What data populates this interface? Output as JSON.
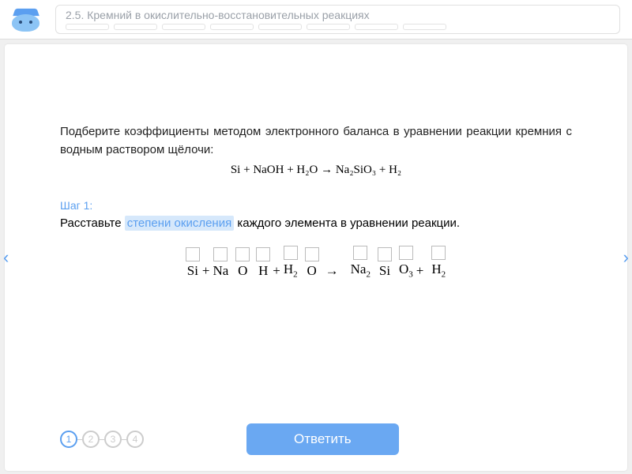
{
  "header": {
    "title": "2.5. Кремний в окислительно-восстановительных реакциях",
    "progress_slots": 8
  },
  "problem": {
    "text": "Подберите коэффициенты методом электронного баланса в уравнении реакции кремния с водным раствором щёлочи:",
    "equation": "Si + NaOH + H₂O → Na₂SiO₃ + H₂"
  },
  "step": {
    "label": "Шаг 1:",
    "prefix": "Расставьте ",
    "highlight": "степени окисления",
    "suffix": " каждого элемента в уравнении реакции."
  },
  "work_tokens": [
    {
      "type": "box",
      "sym": "Si"
    },
    {
      "type": "op",
      "sym": "+"
    },
    {
      "type": "box",
      "sym": "Na"
    },
    {
      "type": "gap"
    },
    {
      "type": "box",
      "sym": "O"
    },
    {
      "type": "gap"
    },
    {
      "type": "box",
      "sym": "H"
    },
    {
      "type": "op",
      "sym": "+"
    },
    {
      "type": "box",
      "sym": "H",
      "sub": "2"
    },
    {
      "type": "gap"
    },
    {
      "type": "box",
      "sym": "O"
    },
    {
      "type": "arrow",
      "sym": "→"
    },
    {
      "type": "gap"
    },
    {
      "type": "box",
      "sym": "Na",
      "sub": "2"
    },
    {
      "type": "gap"
    },
    {
      "type": "box",
      "sym": "Si"
    },
    {
      "type": "gap"
    },
    {
      "type": "box",
      "sym": "O",
      "sub": "3"
    },
    {
      "type": "op",
      "sym": "+"
    },
    {
      "type": "gap"
    },
    {
      "type": "box",
      "sym": "H",
      "sub": "2"
    }
  ],
  "pager": {
    "steps": [
      "1",
      "2",
      "3",
      "4"
    ],
    "active": 0
  },
  "buttons": {
    "answer": "Ответить"
  },
  "nav": {
    "prev": "‹",
    "next": "›"
  }
}
